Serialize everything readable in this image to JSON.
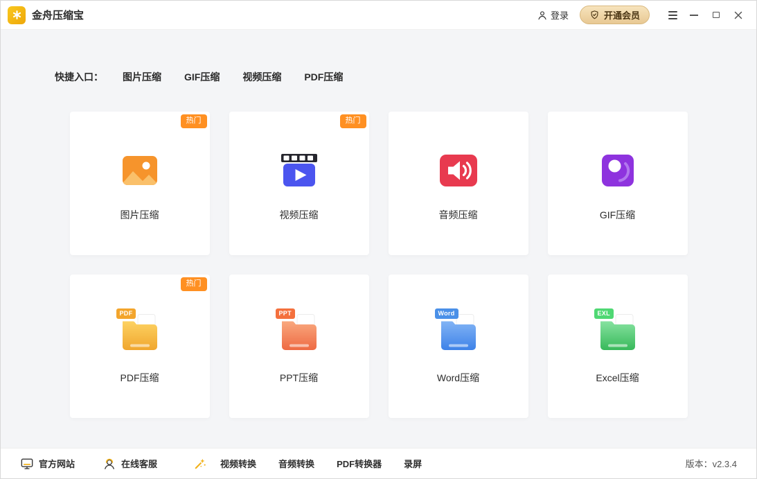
{
  "window": {
    "title": "金舟压缩宝",
    "login_label": "登录",
    "vip_label": "开通会员"
  },
  "labels": {
    "hot": "热门"
  },
  "quick_entry": {
    "label": "快捷入口：",
    "links": [
      "图片压缩",
      "GIF压缩",
      "视频压缩",
      "PDF压缩"
    ]
  },
  "cards": [
    {
      "label": "图片压缩",
      "hot": true,
      "icon": "image-compress-icon"
    },
    {
      "label": "视频压缩",
      "hot": true,
      "icon": "video-compress-icon"
    },
    {
      "label": "音频压缩",
      "hot": false,
      "icon": "audio-compress-icon"
    },
    {
      "label": "GIF压缩",
      "hot": false,
      "icon": "gif-compress-icon"
    },
    {
      "label": "PDF压缩",
      "hot": true,
      "icon": "pdf-folder-icon",
      "badge": "PDF"
    },
    {
      "label": "PPT压缩",
      "hot": false,
      "icon": "ppt-folder-icon",
      "badge": "PPT"
    },
    {
      "label": "Word压缩",
      "hot": false,
      "icon": "word-folder-icon",
      "badge": "Word"
    },
    {
      "label": "Excel压缩",
      "hot": false,
      "icon": "excel-folder-icon",
      "badge": "EXL"
    }
  ],
  "footer": {
    "site_label": "官方网站",
    "service_label": "在线客服",
    "tools": [
      "视频转换",
      "音频转换",
      "PDF转换器",
      "录屏"
    ],
    "version": "版本：v2.3.4"
  },
  "icons": {
    "app-logo-icon": "gold-asterisk-burst",
    "user-icon": "person-outline",
    "membership-badge-icon": "shield-check",
    "menu-icon": "hamburger",
    "minimize-icon": "—",
    "maximize-icon": "□",
    "close-icon": "✕",
    "website-icon": "monitor",
    "service-icon": "headset-person",
    "tools-icon": "magic-wand"
  },
  "colors": {
    "brand_gold": "#f0b410",
    "hot_badge": "#ff9022",
    "image_orange": "#f6942c",
    "video_blue": "#4b55ef",
    "audio_red": "#e83a4f",
    "gif_purple": "#8e33de",
    "pdf_yellow": "#f0a62e",
    "ppt_orange": "#ee6a43",
    "word_blue": "#3e82e8",
    "excel_green": "#38b95a",
    "vip_pill": "#eed3a0",
    "background": "#f4f5f7"
  }
}
